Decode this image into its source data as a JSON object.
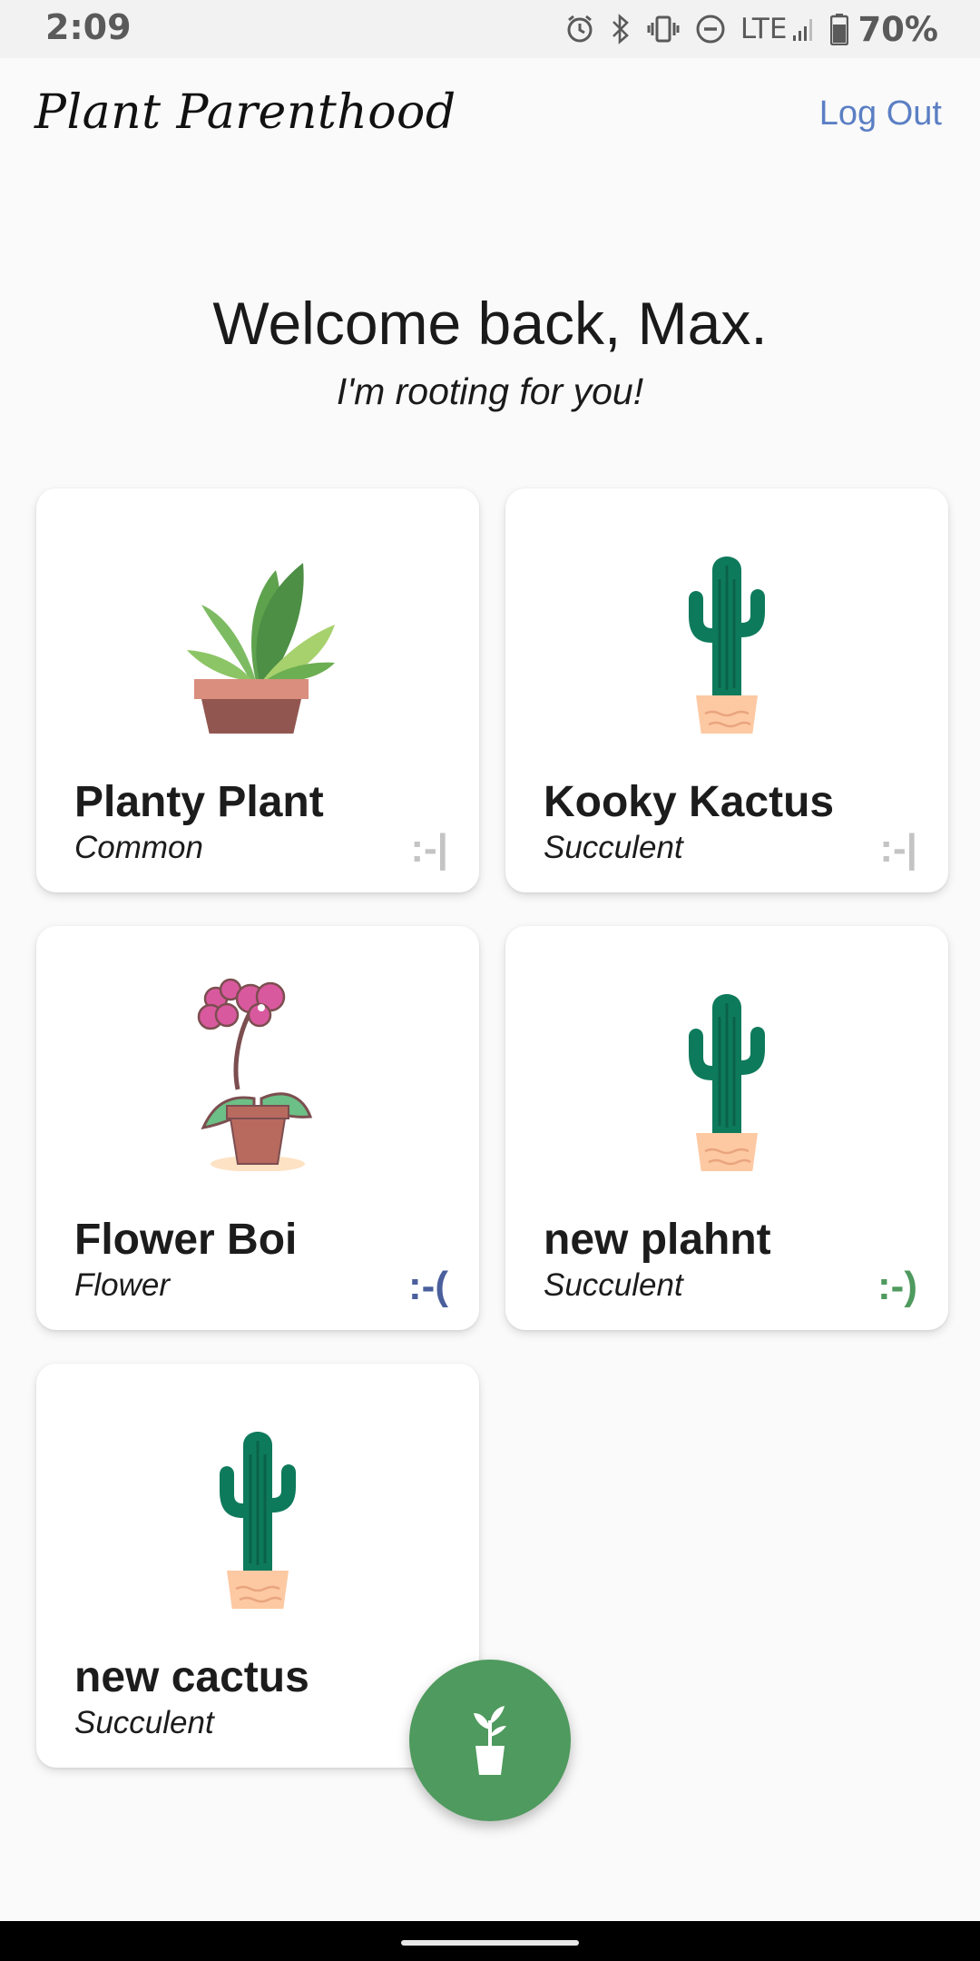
{
  "status_bar": {
    "time": "2:09",
    "network": "LTE",
    "battery": "70%",
    "icons": [
      "alarm-icon",
      "bluetooth-icon",
      "vibrate-icon",
      "do-not-disturb-icon",
      "signal-icon",
      "battery-icon"
    ]
  },
  "header": {
    "app_title": "Plant Parenthood",
    "logout_label": "Log Out"
  },
  "welcome": {
    "title": "Welcome back, Max.",
    "subtitle": "I'm rooting for you!"
  },
  "plants": [
    {
      "name": "Planty Plant",
      "type": "Common",
      "mood": ":-|",
      "mood_color": "#c4c4c4",
      "icon": "potted-plant-icon"
    },
    {
      "name": "Kooky Kactus",
      "type": "Succulent",
      "mood": ":-|",
      "mood_color": "#c4c4c4",
      "icon": "cactus-icon"
    },
    {
      "name": "Flower Boi",
      "type": "Flower",
      "mood": ":-(",
      "mood_color": "#4a5f9c",
      "icon": "orchid-icon"
    },
    {
      "name": "new plahnt",
      "type": "Succulent",
      "mood": ":-)",
      "mood_color": "#4f9a5e",
      "icon": "cactus-icon"
    },
    {
      "name": "new cactus",
      "type": "Succulent",
      "mood": ":-",
      "mood_color": "#4f9a5e",
      "icon": "cactus-icon"
    }
  ],
  "fab": {
    "icon": "add-plant-icon",
    "color": "#4f9a5e"
  },
  "colors": {
    "accent": "#5b7fc4",
    "green": "#4f9a5e",
    "background": "#fafafa"
  }
}
